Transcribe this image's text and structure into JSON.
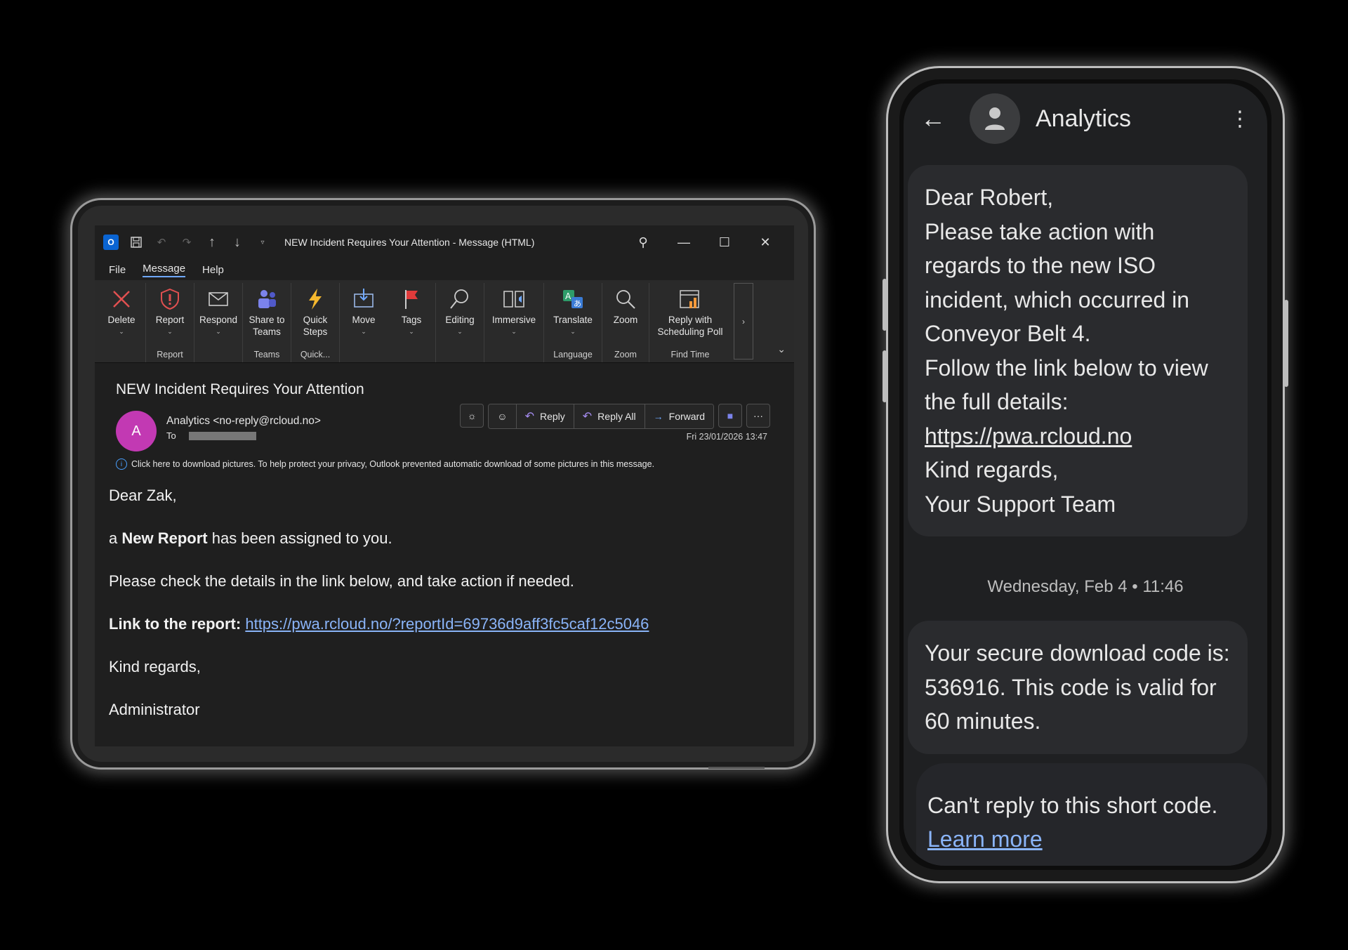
{
  "outlook": {
    "window_title": "NEW Incident Requires Your Attention  -  Message (HTML)",
    "logo_letter": "O",
    "menu": [
      "File",
      "Message",
      "Help"
    ],
    "ribbon": {
      "delete": "Delete",
      "report": "Report",
      "report_group": "Report",
      "respond": "Respond",
      "share_teams": "Share to Teams",
      "teams_group": "Teams",
      "quick_steps": "Quick Steps",
      "quick_group": "Quick...",
      "move": "Move",
      "tags": "Tags",
      "editing": "Editing",
      "immersive": "Immersive",
      "translate": "Translate",
      "language_group": "Language",
      "zoom": "Zoom",
      "zoom_group": "Zoom",
      "reply_poll": "Reply with Scheduling Poll",
      "findtime_group": "Find Time"
    },
    "email": {
      "subject": "NEW Incident Requires Your Attention",
      "avatar_letter": "A",
      "from": "Analytics <no-reply@rcloud.no>",
      "to_label": "To",
      "date": "Fri 23/01/2026 13:47",
      "actions": {
        "reply": "Reply",
        "reply_all": "Reply All",
        "forward": "Forward"
      },
      "info": "Click here to download pictures. To help protect your privacy, Outlook prevented automatic download of some pictures in this message.",
      "greeting": "Dear Zak,",
      "line1_pre": "a ",
      "line1_bold": "New Report",
      "line1_post": " has been assigned to you.",
      "line2": "Please check the details in the link below, and take action if needed.",
      "link_label": "Link to the report:",
      "link_url": "https://pwa.rcloud.no/?reportId=69736d9aff3fc5caf12c5046",
      "signoff": "Kind regards,",
      "signature": "Administrator"
    }
  },
  "sms": {
    "contact": "Analytics",
    "message1": {
      "l1": "Dear Robert,",
      "l2": "Please take action with regards to the new ISO incident, which occurred in Conveyor Belt 4.",
      "l3": "Follow the link below to view the full details:",
      "link": "https://pwa.rcloud.no",
      "l4": "Kind regards,",
      "l5": "Your Support Team"
    },
    "timestamp": "Wednesday, Feb 4 • 11:46",
    "message2": "Your secure download code is: 536916. This code is valid for 60 minutes.",
    "short_code_notice": "Can't reply to this short code.",
    "learn_more": "Learn more"
  }
}
